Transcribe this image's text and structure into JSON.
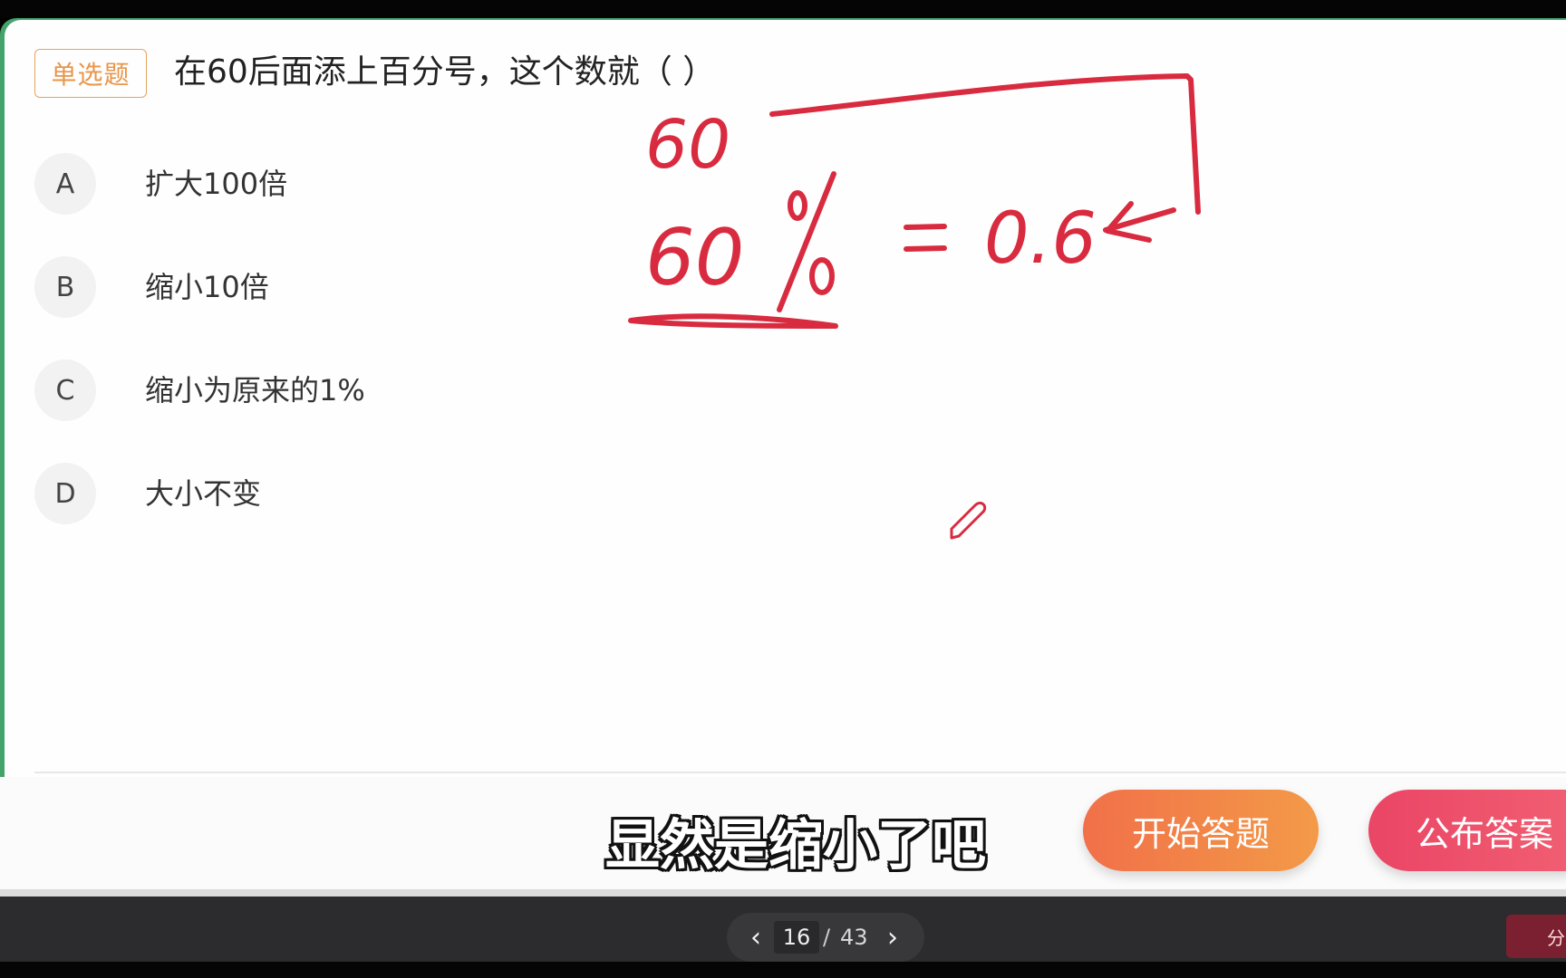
{
  "question": {
    "type_label": "单选题",
    "text": "在60后面添上百分号，这个数就（ ）"
  },
  "options": [
    {
      "letter": "A",
      "text": "扩大100倍"
    },
    {
      "letter": "B",
      "text": "缩小10倍"
    },
    {
      "letter": "C",
      "text": "缩小为原来的1%"
    },
    {
      "letter": "D",
      "text": "大小不变"
    }
  ],
  "subtitle": "显然是缩小了吧",
  "buttons": {
    "start": "开始答题",
    "publish": "公布答案"
  },
  "pager": {
    "current": "16",
    "separator": "/",
    "total": "43"
  },
  "side_button": "分",
  "annotation": {
    "color": "#d92b3f",
    "top_number": "60",
    "percent_number": "60",
    "percent_sign": "%",
    "equals": "=",
    "result": "0.6"
  }
}
